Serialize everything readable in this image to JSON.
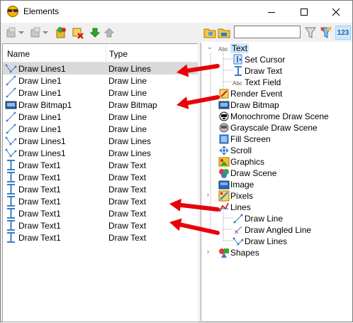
{
  "window": {
    "title": "Elements"
  },
  "list": {
    "headers": {
      "name": "Name",
      "type": "Type"
    },
    "rows": [
      {
        "name": "Draw Lines1",
        "type": "Draw Lines",
        "icon": "draw-lines-icon"
      },
      {
        "name": "Draw Line1",
        "type": "Draw Line",
        "icon": "draw-line-icon"
      },
      {
        "name": "Draw Line1",
        "type": "Draw Line",
        "icon": "draw-line-icon"
      },
      {
        "name": "Draw Bitmap1",
        "type": "Draw Bitmap",
        "icon": "draw-bitmap-icon"
      },
      {
        "name": "Draw Line1",
        "type": "Draw Line",
        "icon": "draw-line-icon"
      },
      {
        "name": "Draw Line1",
        "type": "Draw Line",
        "icon": "draw-line-icon"
      },
      {
        "name": "Draw Lines1",
        "type": "Draw Lines",
        "icon": "draw-lines-icon"
      },
      {
        "name": "Draw Lines1",
        "type": "Draw Lines",
        "icon": "draw-lines-icon"
      },
      {
        "name": "Draw Text1",
        "type": "Draw Text",
        "icon": "draw-text-icon"
      },
      {
        "name": "Draw Text1",
        "type": "Draw Text",
        "icon": "draw-text-icon"
      },
      {
        "name": "Draw Text1",
        "type": "Draw Text",
        "icon": "draw-text-icon"
      },
      {
        "name": "Draw Text1",
        "type": "Draw Text",
        "icon": "draw-text-icon"
      },
      {
        "name": "Draw Text1",
        "type": "Draw Text",
        "icon": "draw-text-icon"
      },
      {
        "name": "Draw Text1",
        "type": "Draw Text",
        "icon": "draw-text-icon"
      },
      {
        "name": "Draw Text1",
        "type": "Draw Text",
        "icon": "draw-text-icon"
      }
    ]
  },
  "search": {
    "value": ""
  },
  "tree": {
    "text": "Text",
    "set_cursor": "Set Cursor",
    "draw_text": "Draw Text",
    "text_field": "Text Field",
    "render_event": "Render Event",
    "draw_bitmap": "Draw Bitmap",
    "monochrome": "Monochrome Draw Scene",
    "grayscale": "Grayscale Draw Scene",
    "fill_screen": "Fill Screen",
    "scroll": "Scroll",
    "graphics": "Graphics",
    "draw_scene": "Draw Scene",
    "image": "Image",
    "pixels": "Pixels",
    "lines": "Lines",
    "draw_line": "Draw Line",
    "draw_angled_line": "Draw Angled Line",
    "draw_lines": "Draw Lines",
    "shapes": "Shapes"
  },
  "colors": {
    "selection": "#d9d9d9",
    "annotation_arrow": "#e8000b",
    "tree_highlight": "#cce8ff"
  }
}
